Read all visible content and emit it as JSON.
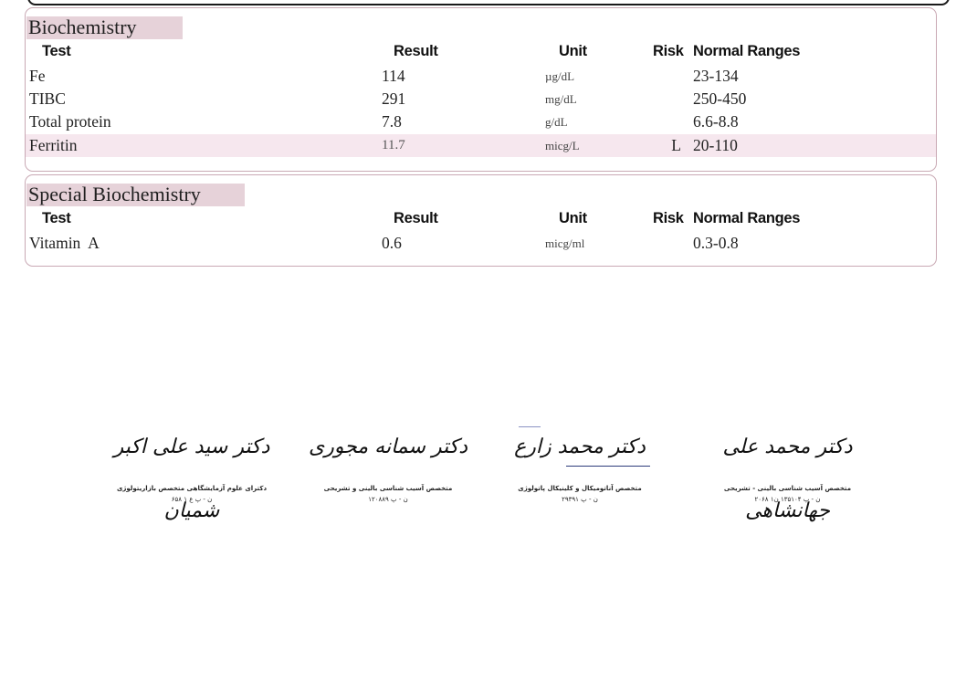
{
  "sections": [
    {
      "title": "Biochemistry",
      "headers": {
        "test": "Test",
        "result": "Result",
        "unit": "Unit",
        "risk": "Risk",
        "range": "Normal Ranges"
      },
      "rows": [
        {
          "test": "Fe",
          "result": "114",
          "unit": "µg/dL",
          "risk": "",
          "range": "23-134",
          "flagged": false
        },
        {
          "test": "TIBC",
          "result": "291",
          "unit": "mg/dL",
          "risk": "",
          "range": "250-450",
          "flagged": false
        },
        {
          "test": "Total protein",
          "result": "7.8",
          "unit": "g/dL",
          "risk": "",
          "range": "6.6-8.8",
          "flagged": false
        },
        {
          "test": "Ferritin",
          "result": "11.7",
          "unit": "micg/L",
          "risk": "L",
          "range": "20-110",
          "flagged": true
        }
      ]
    },
    {
      "title": "Special Biochemistry",
      "headers": {
        "test": "Test",
        "result": "Result",
        "unit": "Unit",
        "risk": "Risk",
        "range": "Normal Ranges"
      },
      "rows": [
        {
          "test": "Vitamin  A",
          "result": "0.6",
          "unit": "micg/ml",
          "risk": "",
          "range": "0.3-0.8",
          "flagged": false
        }
      ]
    }
  ],
  "colors": {
    "section_title_bg": "#e6d2d9",
    "flag_row_bg": "#f6e7ee",
    "panel_border": "#c9a9b4"
  },
  "signatures": [
    {
      "name": "دکتر سید علی اکبر شمیان",
      "title": "دکترای علوم آزمایشگاهی متخصص بازاریتولوژی",
      "license": "ن - پ ع ۱ ۶۵۸"
    },
    {
      "name": "دکتر سمانه مجوری",
      "title": "متخصص آسیب شناسی بالینی و تشریحی",
      "license": "ن - پ ۱۲۰۸۸۹"
    },
    {
      "name": "دکتر محمد زارع",
      "title": "متخصص آناتومیکال و کلینیکال پاتولوژی",
      "license": "ن - پ ۲۹۳۹۱"
    },
    {
      "name": "دکتر محمد علی جهانشاهی",
      "title": "متخصص آسیب شناسی بالینی - تشریحی",
      "license": "ن - پ ۱۳۵۱۰۴   ن۱ ۲۰۶۸"
    }
  ]
}
